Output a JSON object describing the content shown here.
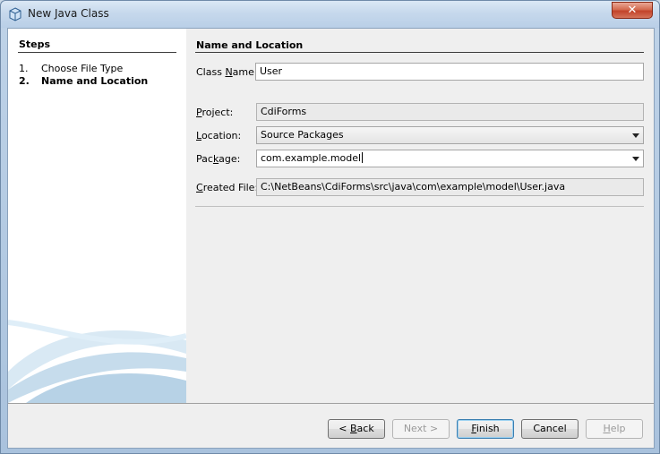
{
  "window": {
    "title": "New Java Class",
    "close_label": "✕"
  },
  "steps": {
    "title": "Steps",
    "items": [
      {
        "num": "1.",
        "label": "Choose File Type"
      },
      {
        "num": "2.",
        "label": "Name and Location"
      }
    ]
  },
  "section": {
    "title": "Name and Location",
    "class_name_label_pre": "Class ",
    "class_name_label_u": "N",
    "class_name_label_post": "ame:",
    "class_name_value": "User",
    "project_label_u": "P",
    "project_label_post": "roject:",
    "project_value": "CdiForms",
    "location_label_u": "L",
    "location_label_post": "ocation:",
    "location_value": "Source Packages",
    "package_label_pre": "Pac",
    "package_label_u": "k",
    "package_label_post": "age:",
    "package_value": "com.example.model",
    "created_label_u": "C",
    "created_label_post": "reated File:",
    "created_value": "C:\\NetBeans\\CdiForms\\src\\java\\com\\example\\model\\User.java"
  },
  "buttons": {
    "back_pre": "< ",
    "back_u": "B",
    "back_post": "ack",
    "next": "Next >",
    "finish_u": "F",
    "finish_post": "inish",
    "cancel": "Cancel",
    "help_u": "H",
    "help_post": "elp"
  }
}
